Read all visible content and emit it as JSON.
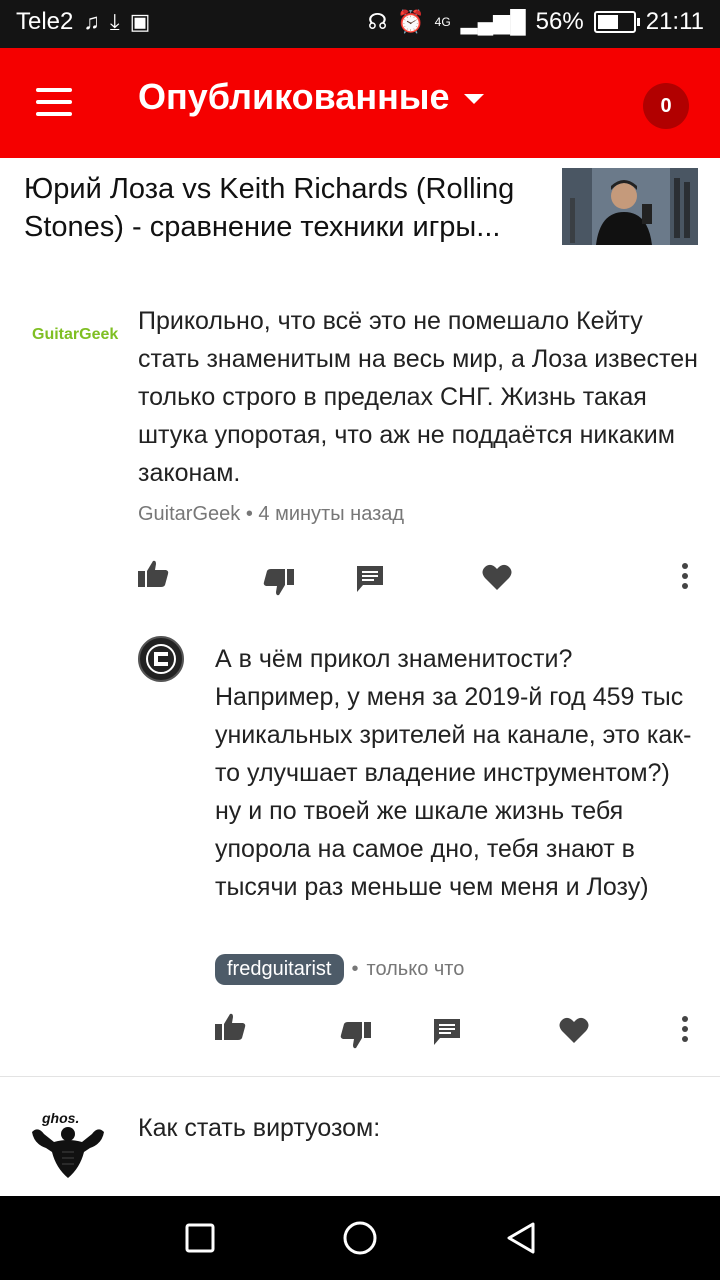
{
  "status_bar": {
    "carrier": "Tele2",
    "network": "4G",
    "battery_percent": "56%",
    "time": "21:11",
    "icons": [
      "music-icon",
      "download-icon",
      "gallery-icon",
      "headphones-icon",
      "alarm-icon",
      "signal-icon",
      "battery-icon"
    ]
  },
  "app_bar": {
    "title": "Опубликованные",
    "badge_count": "0",
    "color": "#f50000"
  },
  "video": {
    "title": "Юрий Лоза vs Keith Richards (Rolling Stones) - сравнение техники игры..."
  },
  "comments": [
    {
      "avatar_text": "GuitarGeek",
      "text": "Прикольно, что всё это не помешало Кейту стать знаменитым на весь мир, а Лоза известен только строго в пределах СНГ. Жизнь такая штука упоротая, что аж не поддаётся никаким законам.",
      "author": "GuitarGeek",
      "separator": "•",
      "time": "4 минуты назад",
      "reply": {
        "text": "А в чём прикол знаменитости? Например, у меня за 2019-й год 459 тыс уникальных зрителей на канале, это как-то улучшает владение инструментом?) ну и по твоей же шкале жизнь тебя упорола на самое дно, тебя знают в тысячи раз меньше чем меня и Лозу)",
        "author": "fredguitarist",
        "separator": "•",
        "time": "только что"
      }
    },
    {
      "avatar_text": "ghos.",
      "text": "Как стать виртуозом:"
    }
  ],
  "nav_bar": {
    "icons": [
      "square-icon",
      "circle-icon",
      "back-triangle-icon"
    ]
  }
}
